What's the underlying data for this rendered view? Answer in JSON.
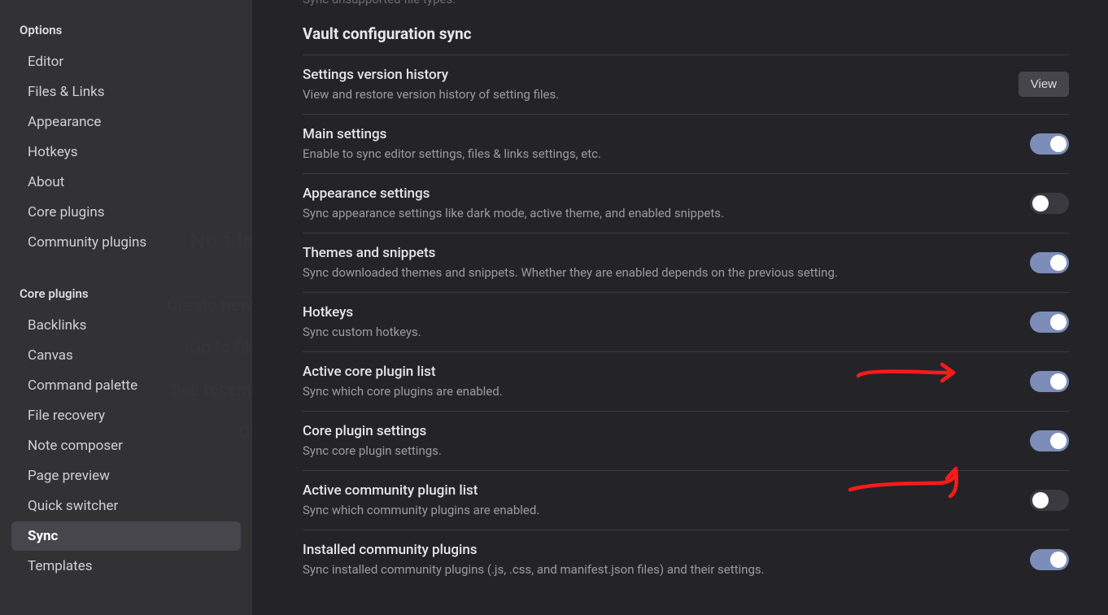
{
  "ghost": {
    "title": "No file is open",
    "items": [
      "Create new file (Ctrl + N)",
      "Go to file (Ctrl + O)",
      "See recent files (Ctrl + )",
      "Close"
    ]
  },
  "sidebar": {
    "sections": [
      {
        "header": "Options",
        "items": [
          {
            "label": "Editor",
            "active": false
          },
          {
            "label": "Files & Links",
            "active": false
          },
          {
            "label": "Appearance",
            "active": false
          },
          {
            "label": "Hotkeys",
            "active": false
          },
          {
            "label": "About",
            "active": false
          },
          {
            "label": "Core plugins",
            "active": false
          },
          {
            "label": "Community plugins",
            "active": false
          }
        ]
      },
      {
        "header": "Core plugins",
        "items": [
          {
            "label": "Backlinks",
            "active": false
          },
          {
            "label": "Canvas",
            "active": false
          },
          {
            "label": "Command palette",
            "active": false
          },
          {
            "label": "File recovery",
            "active": false
          },
          {
            "label": "Note composer",
            "active": false
          },
          {
            "label": "Page preview",
            "active": false
          },
          {
            "label": "Quick switcher",
            "active": false
          },
          {
            "label": "Sync",
            "active": true
          },
          {
            "label": "Templates",
            "active": false
          }
        ]
      }
    ]
  },
  "main": {
    "truncated_text": "Sync unsupported file types.",
    "section_heading": "Vault configuration sync",
    "settings": [
      {
        "title": "Settings version history",
        "desc": "View and restore version history of setting files.",
        "control_type": "button",
        "button_label": "View"
      },
      {
        "title": "Main settings",
        "desc": "Enable to sync editor settings, files & links settings, etc.",
        "control_type": "toggle",
        "toggle_on": true
      },
      {
        "title": "Appearance settings",
        "desc": "Sync appearance settings like dark mode, active theme, and enabled snippets.",
        "control_type": "toggle",
        "toggle_on": false
      },
      {
        "title": "Themes and snippets",
        "desc": "Sync downloaded themes and snippets. Whether they are enabled depends on the previous setting.",
        "control_type": "toggle",
        "toggle_on": true
      },
      {
        "title": "Hotkeys",
        "desc": "Sync custom hotkeys.",
        "control_type": "toggle",
        "toggle_on": true
      },
      {
        "title": "Active core plugin list",
        "desc": "Sync which core plugins are enabled.",
        "control_type": "toggle",
        "toggle_on": true
      },
      {
        "title": "Core plugin settings",
        "desc": "Sync core plugin settings.",
        "control_type": "toggle",
        "toggle_on": true
      },
      {
        "title": "Active community plugin list",
        "desc": "Sync which community plugins are enabled.",
        "control_type": "toggle",
        "toggle_on": false
      },
      {
        "title": "Installed community plugins",
        "desc": "Sync installed community plugins (.js, .css, and manifest.json files) and their settings.",
        "control_type": "toggle",
        "toggle_on": true
      }
    ]
  }
}
